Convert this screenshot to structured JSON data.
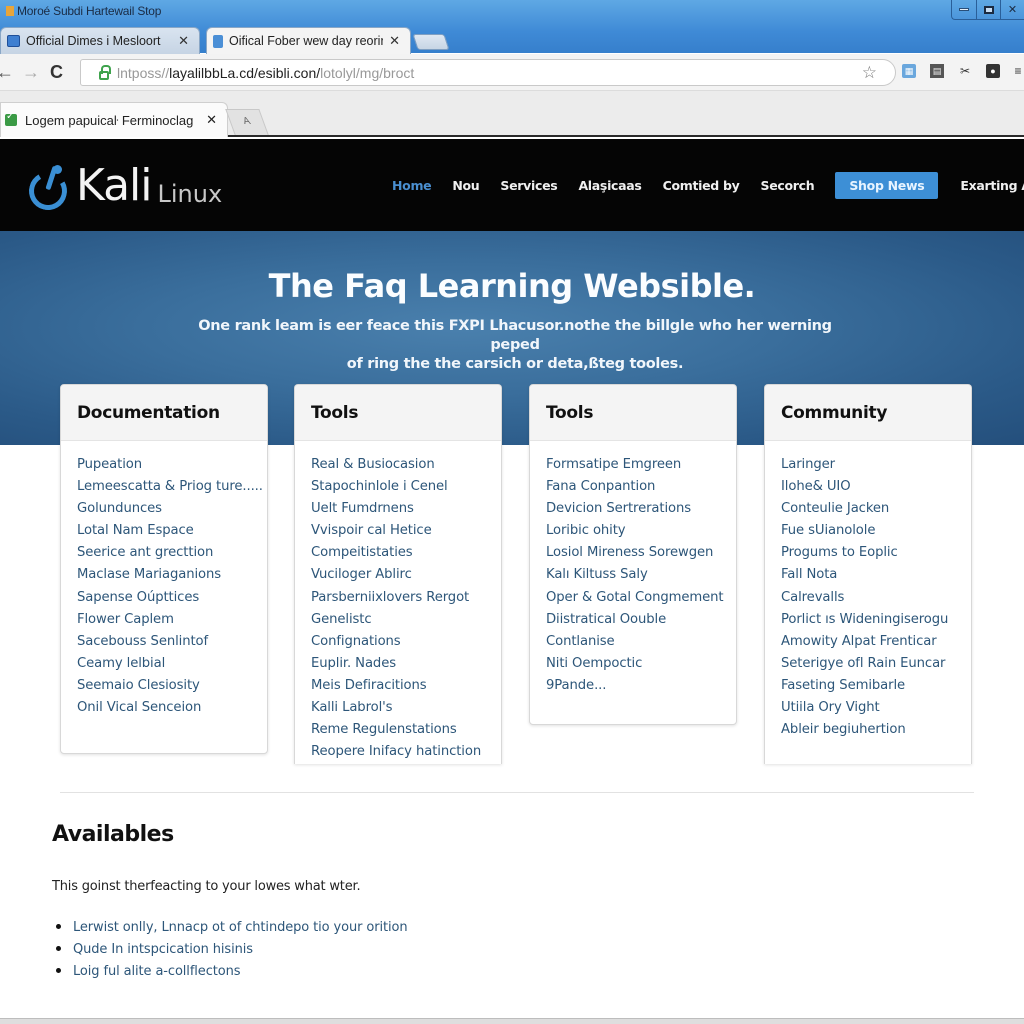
{
  "window": {
    "title": "Moroé Subdi Hartewail Stop",
    "controls": {
      "minimize": "minimize",
      "maximize": "maximize",
      "close": "✕"
    }
  },
  "browser_tabs": [
    {
      "label": "Official Dimes i Mesloort",
      "close": "✕",
      "active": false
    },
    {
      "label": "Oifical Fober wew day reorirer",
      "close": "✕",
      "active": true
    }
  ],
  "toolbar": {
    "back": "←",
    "forward": "→",
    "reload": "C",
    "url_scheme": "lntposs//",
    "url_host": "layalilbbLa.cd/esibli.con/",
    "url_path": "lotolyl/mg/broct",
    "bookmark": "☆",
    "extensions": [
      "ext-1",
      "ext-2",
      "ext-3",
      "ext-4"
    ],
    "menu": "≡"
  },
  "secondary_tab": {
    "label": "Logem papuicaŀ Ferminoclag",
    "close": "✕",
    "new_tab": "A"
  },
  "site": {
    "logo_main": "Kali",
    "logo_sub": "Linux",
    "nav": [
      {
        "label": "Home",
        "current": true
      },
      {
        "label": "Nou"
      },
      {
        "label": "Services"
      },
      {
        "label": "Alaşicaas"
      },
      {
        "label": "Comtied by"
      },
      {
        "label": "Secorch"
      },
      {
        "label": "Shop News",
        "cta": true
      },
      {
        "label": "Exarting Aactoss"
      }
    ],
    "hero_title": "The Faq Learning Websible.",
    "hero_subtitle_line1": "One rank leam is eer feace this FXPI Lhacusor.nothe the billgle who her werning peped",
    "hero_subtitle_line2": "of ring the the carsich or deta,ßteg tooles.",
    "cards": [
      {
        "title": "Documentation",
        "items": [
          "Pupeation",
          "Lemeescatta & Priog ture.....",
          "Golundunces",
          "Lotal Nam Espace",
          "Seerice ant grecttion",
          "Maclase Mariaganions",
          "Sapense Oúpttices",
          "Flower Caplem",
          "Sacebouss Senlintof",
          "Ceamy lelbial",
          "Seemaio Clesiosity",
          "Onil Vical Senceion"
        ]
      },
      {
        "title": "Tools",
        "items": [
          "Real & Busiocasion",
          "Stapochinlole i Cenel",
          "Uelt Fumdrnens",
          "Vvispoir cal Hetice",
          "Compeitistaties",
          "Vuciloger Ablirc",
          "Parsberniixlovers Rergot",
          "Genelistc",
          "Confignations",
          "Euplir. Nades",
          "Meis Defiracitions",
          "Kalli Labrol's",
          "Reme Regulenstations",
          "Reopere Inifacy hatinction"
        ]
      },
      {
        "title": "Tools",
        "items": [
          "Formsatipe Emgreen",
          "Fana Conpantion",
          "Devicion Sertrerations",
          "Loribic ohity",
          "Losiol Mireness Sorewgen",
          "Kalı Kiltuss Saly",
          "Oper & Gotal Congmement",
          "Diistratical Oouble",
          "Contlanise",
          "Niti Oempoctic",
          "9Pande..."
        ]
      },
      {
        "title": "Community",
        "items": [
          "Laringer",
          "Ilohe& UIO",
          "Conteulie Jacken",
          "Fue sUianolole",
          "Progums to Eoplic",
          "Fall Nota",
          "Calrevalls",
          "Porlict ıs Wideningiserogu",
          "Amowity Alpat Frenticar",
          "Seterigye ofl Rain Euncar",
          "Faseting Semibarle",
          "Utiila Ory Vight",
          "Ableir begiuhertion"
        ]
      }
    ],
    "availables": {
      "title": "Availables",
      "description": "This goinst therfeacting to your lowes what wter.",
      "items": [
        "Lerwist onlly, Lnnacp ot of chtindepo tio your orition",
        "Qude In intspcication hisinis",
        "Loig ful alite a-collflectons"
      ]
    }
  },
  "colors": {
    "titlebar": "#3f8ad6",
    "site_header": "#050505",
    "accent": "#3d8fd6",
    "hero": "#3a6e9c",
    "link": "#2d5679"
  }
}
